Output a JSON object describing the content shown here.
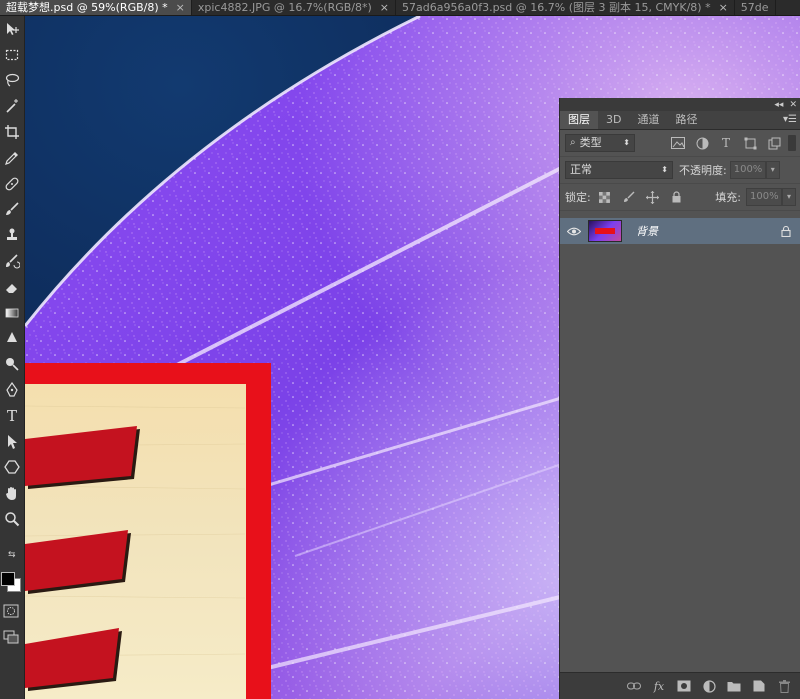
{
  "tabs": [
    {
      "label": "超载梦想.psd @ 59%(RGB/8) *",
      "active": true
    },
    {
      "label": "xpic4882.JPG @ 16.7%(RGB/8*)",
      "active": false
    },
    {
      "label": "57ad6a956a0f3.psd @ 16.7% (图层 3 副本 15, CMYK/8) *",
      "active": false
    },
    {
      "label": "57de",
      "active": false
    }
  ],
  "tab_close": "×",
  "toolbar": {
    "tools": [
      "move-icon",
      "marquee-icon",
      "lasso-icon",
      "magic-wand-icon",
      "crop-icon",
      "eyedropper-icon",
      "healing-brush-icon",
      "brush-icon",
      "clone-stamp-icon",
      "history-brush-icon",
      "eraser-icon",
      "gradient-icon",
      "blur-icon",
      "dodge-icon",
      "pen-icon",
      "type-icon",
      "path-selection-icon",
      "shape-icon",
      "hand-icon",
      "zoom-icon"
    ],
    "type_tool_glyph": "T",
    "foreground_color": "#000000",
    "background_color": "#ffffff"
  },
  "panel": {
    "tabs": [
      "图层",
      "3D",
      "通道",
      "路径"
    ],
    "filter_label": "类型",
    "blend_mode": "正常",
    "opacity_label": "不透明度:",
    "opacity_value": "100%",
    "lock_label": "锁定:",
    "fill_label": "填充:",
    "fill_value": "100%",
    "layers": [
      {
        "name": "背景",
        "visible": true,
        "locked": true
      }
    ],
    "footer_icons": [
      "link-layers-icon",
      "fx-icon",
      "add-mask-icon",
      "adjustment-layer-icon",
      "group-folder-icon",
      "new-layer-icon",
      "trash-icon"
    ],
    "fx_label": "fx"
  },
  "colors": {
    "sky": "#0d2a5c",
    "purple": "#7a3ff0",
    "sign_border": "#e8101a",
    "sign_face": "#f2e2b0",
    "bars": "#c4121f",
    "layer_selected": "#5f6f80"
  }
}
